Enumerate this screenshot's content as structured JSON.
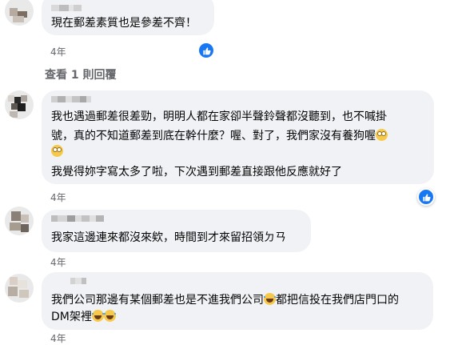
{
  "comments": [
    {
      "text_lines": [
        "現在郵差素質也是參差不齊！"
      ],
      "time": "4年",
      "view_replies": "查看 1 則回覆"
    },
    {
      "text_lines": [
        "我也遇過郵差很差勁，明明人都在家卻半聲鈴聲都沒聽到，也不喊掛",
        "號，真的不知道郵差到底在幹什麼？喔、對了，我們家沒有養狗喔",
        "",
        "我覺得妳字寫太多了啦，下次遇到郵差直接跟他反應就好了"
      ],
      "time": "4年"
    },
    {
      "text_lines": [
        "我家這邊連來都沒來欸，時間到才來留招領ㄉㄢ"
      ],
      "time": "4年"
    },
    {
      "text_lines": [
        "我們公司那邊有某個郵差也是不進我們公司",
        "都把信投在我們店門口的",
        "DM架裡"
      ],
      "time": "4年"
    }
  ],
  "colors": {
    "bubble": "#f0f2f5",
    "like": "#1877f2",
    "meta": "#65676b"
  },
  "icons": {
    "reaction": "like-reaction-icon",
    "emoji_rolling_eyes": "rolling-eyes-emoji-icon",
    "emoji_laughing": "laughing-emoji-icon"
  }
}
